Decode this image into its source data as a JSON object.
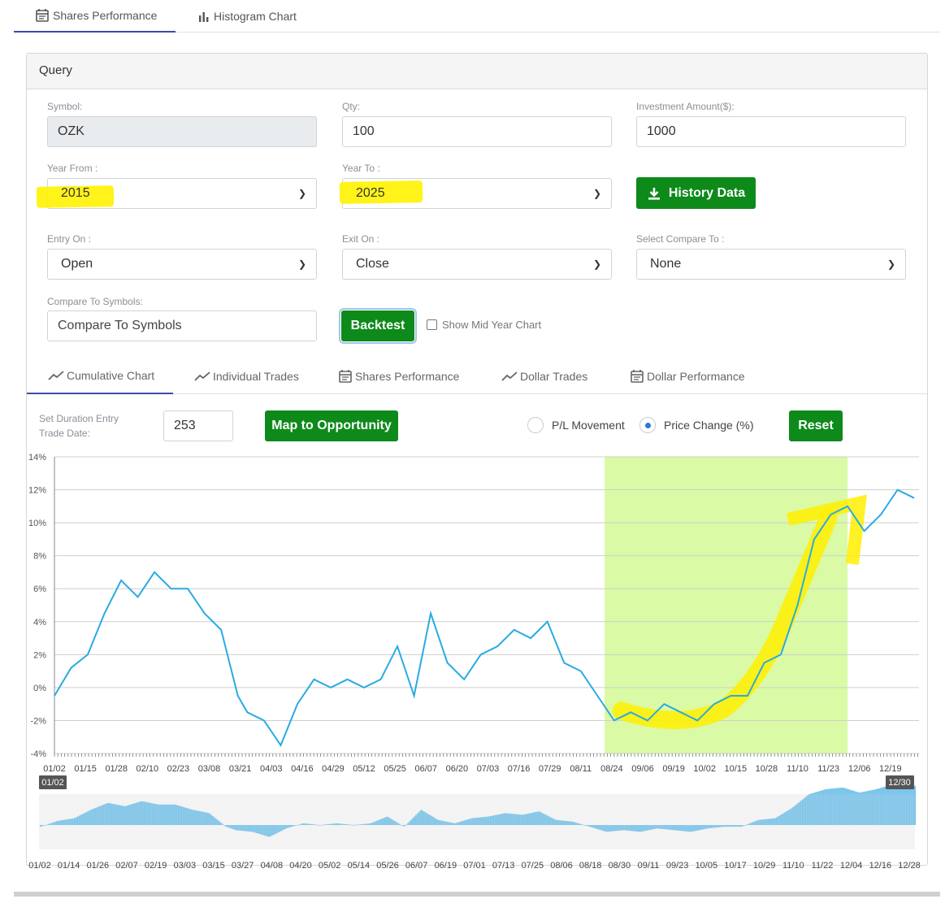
{
  "top_tabs": [
    {
      "label": "Shares Performance",
      "icon": "calendar-icon",
      "active": true
    },
    {
      "label": "Histogram Chart",
      "icon": "bar-chart-icon",
      "active": false
    }
  ],
  "query": {
    "title": "Query",
    "symbol": {
      "label": "Symbol:",
      "value": "OZK"
    },
    "qty": {
      "label": "Qty:",
      "value": "100"
    },
    "investment": {
      "label": "Investment Amount($):",
      "value": "1000"
    },
    "year_from": {
      "label": "Year From :",
      "value": "2015"
    },
    "year_to": {
      "label": "Year To :",
      "value": "2025"
    },
    "history_button": "History Data",
    "entry_on": {
      "label": "Entry On :",
      "value": "Open"
    },
    "exit_on": {
      "label": "Exit On :",
      "value": "Close"
    },
    "compare_to": {
      "label": "Select Compare To :",
      "value": "None"
    },
    "compare_symbols": {
      "label": "Compare To Symbols:",
      "placeholder": "Compare To Symbols"
    },
    "backtest_button": "Backtest",
    "show_mid_year": "Show Mid Year Chart"
  },
  "chart_tabs": [
    {
      "label": "Cumulative Chart",
      "icon": "line-chart-icon",
      "active": true
    },
    {
      "label": "Individual Trades",
      "icon": "line-chart-icon",
      "active": false
    },
    {
      "label": "Shares Performance",
      "icon": "calendar-icon",
      "active": false
    },
    {
      "label": "Dollar Trades",
      "icon": "line-chart-icon",
      "active": false
    },
    {
      "label": "Dollar Performance",
      "icon": "calendar-icon",
      "active": false
    }
  ],
  "controls": {
    "duration_label_1": "Set Duration Entry",
    "duration_label_2": "Trade Date:",
    "duration_value": "253",
    "map_button": "Map to Opportunity",
    "radio_pl": "P/L Movement",
    "radio_price": "Price Change (%)",
    "radio_selected": "Price Change (%)",
    "reset_button": "Reset"
  },
  "colors": {
    "accent_green": "#0e8a1b",
    "line": "#29abe2",
    "highlight": "#fff200",
    "selection": "#d6f99b",
    "active_tab": "#3a4ea8"
  },
  "chart_data": {
    "type": "line",
    "ylim": [
      -4,
      14
    ],
    "y_ticks": [
      "14%",
      "12%",
      "10%",
      "8%",
      "6%",
      "4%",
      "2%",
      "0%",
      "-2%",
      "-4%"
    ],
    "x_ticks": [
      "01/02",
      "01/15",
      "01/28",
      "02/10",
      "02/23",
      "03/08",
      "03/21",
      "04/03",
      "04/16",
      "04/29",
      "05/12",
      "05/25",
      "06/07",
      "06/20",
      "07/03",
      "07/16",
      "07/29",
      "08/11",
      "08/24",
      "09/06",
      "09/19",
      "10/02",
      "10/15",
      "10/28",
      "11/10",
      "11/23",
      "12/06",
      "12/19"
    ],
    "selection_range": [
      "08/21",
      "12/01"
    ],
    "series": [
      {
        "x": [
          "01/02",
          "01/09",
          "01/16",
          "01/23",
          "01/30",
          "02/06",
          "02/13",
          "02/20",
          "02/27",
          "03/06",
          "03/13",
          "03/20",
          "03/24",
          "03/31",
          "04/07",
          "04/14",
          "04/21",
          "04/28",
          "05/05",
          "05/12",
          "05/19",
          "05/26",
          "06/02",
          "06/09",
          "06/16",
          "06/23",
          "06/30",
          "07/07",
          "07/14",
          "07/21",
          "07/28",
          "08/04",
          "08/11",
          "08/18",
          "08/25",
          "09/01",
          "09/08",
          "09/15",
          "09/22",
          "09/29",
          "10/06",
          "10/13",
          "10/20",
          "10/27",
          "11/03",
          "11/10",
          "11/17",
          "11/24",
          "12/01",
          "12/08",
          "12/15",
          "12/22",
          "12/29"
        ],
        "values": [
          -0.5,
          1.2,
          2.0,
          4.5,
          6.5,
          5.5,
          7.0,
          6.0,
          6.0,
          4.5,
          3.5,
          -0.5,
          -1.5,
          -2.0,
          -3.5,
          -1.0,
          0.5,
          0.0,
          0.5,
          0.0,
          0.5,
          2.5,
          -0.5,
          4.5,
          1.5,
          0.5,
          2.0,
          2.5,
          3.5,
          3.0,
          4.0,
          1.5,
          1.0,
          -0.5,
          -2.0,
          -1.5,
          -2.0,
          -1.0,
          -1.5,
          -2.0,
          -1.0,
          -0.5,
          -0.5,
          1.5,
          2.0,
          5.0,
          9.0,
          10.5,
          11.0,
          9.5,
          10.5,
          12.0,
          11.5
        ]
      }
    ],
    "nav_x_ticks": [
      "01/02",
      "01/14",
      "01/26",
      "02/07",
      "02/19",
      "03/03",
      "03/15",
      "03/27",
      "04/08",
      "04/20",
      "05/02",
      "05/14",
      "05/26",
      "06/07",
      "06/19",
      "07/01",
      "07/13",
      "07/25",
      "08/06",
      "08/18",
      "08/30",
      "09/11",
      "09/23",
      "10/05",
      "10/17",
      "10/29",
      "11/10",
      "11/22",
      "12/04",
      "12/16",
      "12/28"
    ],
    "nav_start": "01/02",
    "nav_end": "12/30"
  }
}
